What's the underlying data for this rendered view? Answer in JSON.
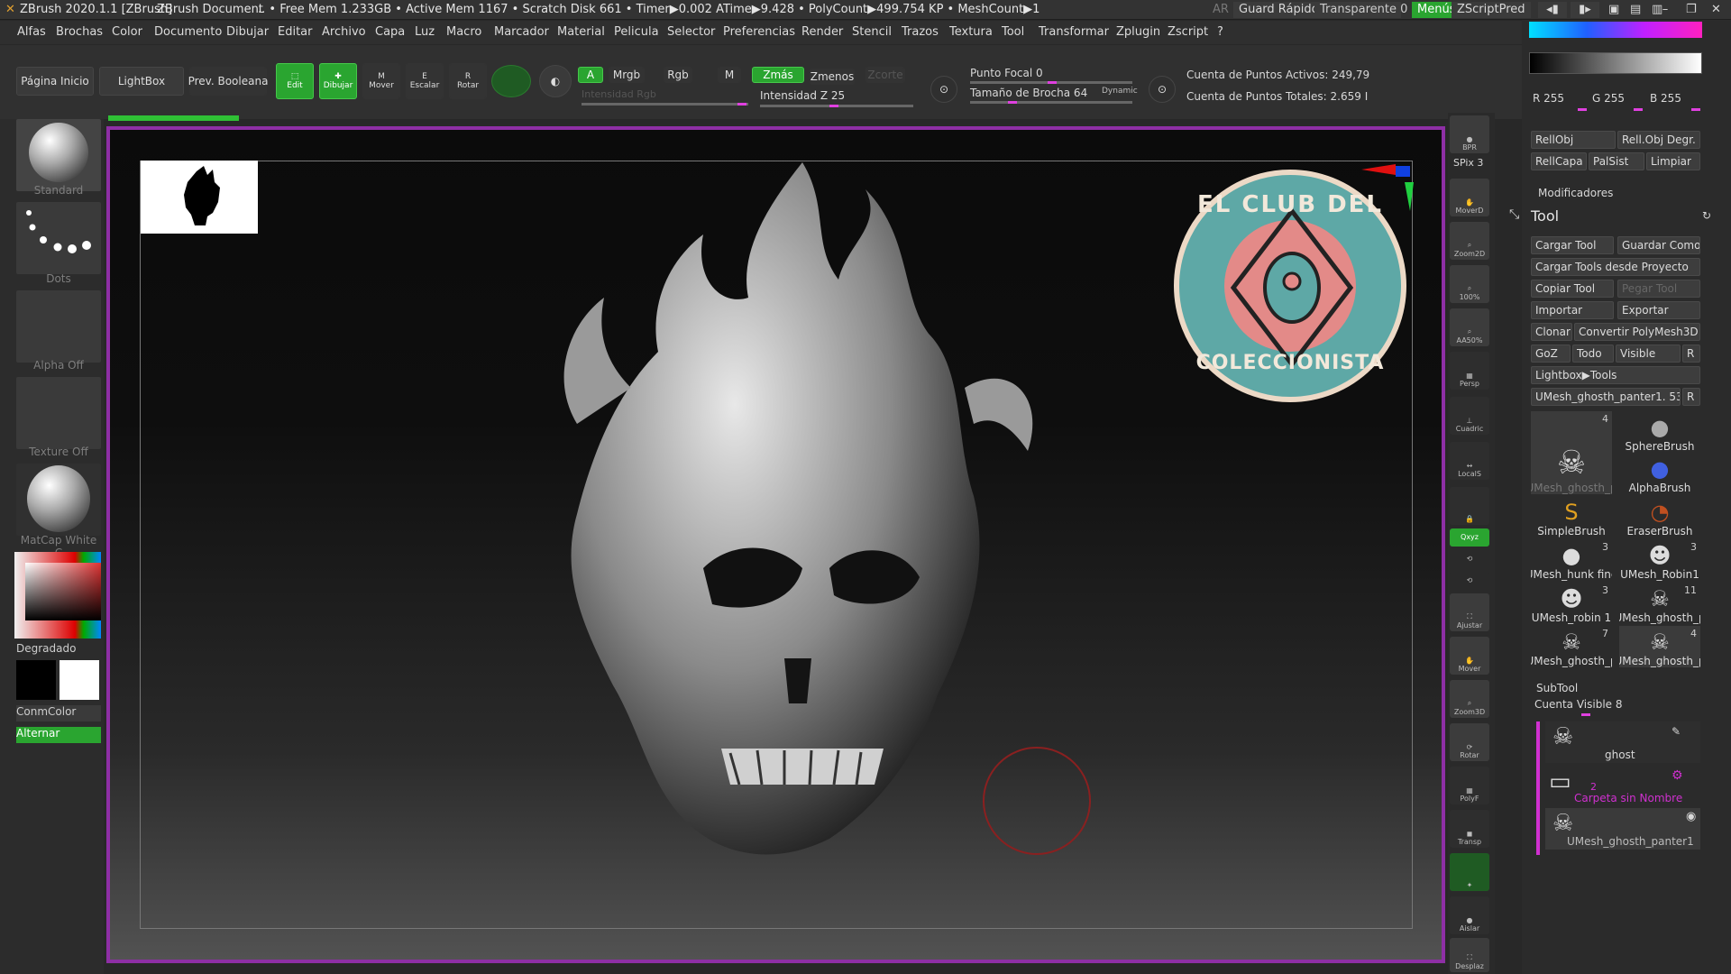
{
  "titlebar": {
    "app": "ZBrush 2020.1.1 [ZBrush]",
    "doc": "ZBrush Document",
    "stats": ".. • Free Mem 1.233GB • Active Mem 1167 • Scratch Disk 661 • Timer▶0.002 ATime▶9.428 • PolyCount▶499.754 KP • MeshCount▶1",
    "ar": "AR",
    "quicksave": "Guard Rápido",
    "transparent": "Transparente 0",
    "menus": "Menús",
    "script": "ZScriptPred"
  },
  "menubar": [
    "Alfas",
    "Brochas",
    "Color",
    "Documento",
    "Dibujar",
    "Editar",
    "Archivo",
    "Capa",
    "Luz",
    "Macro",
    "Marcador",
    "Material",
    "Pelicula",
    "Preferencias",
    "Render",
    "Selector",
    "Stencil",
    "Trazos",
    "Textura",
    "Tool",
    "Transformar",
    "Zplugin",
    "Zscript",
    "?"
  ],
  "topshelf": {
    "home": "Página Inicio",
    "lightbox": "LightBox",
    "bool": "Prev. Booleana",
    "edit": "Edit",
    "draw": "Dibujar",
    "move": "Mover",
    "scale": "Escalar",
    "rotate": "Rotar",
    "a": "A",
    "mrgb": "Mrgb",
    "rgb": "Rgb",
    "m": "M",
    "rgb_intensity": "Intensidad Rgb",
    "zadd": "Zmás",
    "zsub": "Zmenos",
    "zcut": "Zcorte",
    "z_intensity": "Intensidad Z 25",
    "focal": "Punto Focal 0",
    "brush_size": "Tamaño de Brocha 64",
    "dynamic": "Dynamic",
    "active_points": "Cuenta de Puntos Activos: 249,79",
    "total_points": "Cuenta de Puntos Totales: 2.659 I"
  },
  "leftpanel": {
    "brush": "Standard",
    "stroke": "Dots",
    "alpha": "Alpha Off",
    "texture": "Texture Off",
    "material": "MatCap White C",
    "gradient": "Degradado",
    "switch": "ConmColor",
    "alternate": "Alternar"
  },
  "canvas": {
    "logo_text_top": "EL CLUB DEL",
    "logo_text_bottom": "COLECCIONISTA"
  },
  "righttray": [
    "BPR",
    "SPix 3",
    "MoverD",
    "Zoom2D",
    "100%",
    "AA50%",
    "Persp",
    "Cuadric",
    "LocalS",
    "",
    "Qxyz",
    "",
    "",
    "Ajustar",
    "Mover",
    "Zoom3D",
    "Rotar",
    "PolyF",
    "Transp",
    "",
    "Aislar",
    "Desplaz"
  ],
  "rightpanel": {
    "r": "R 255",
    "g": "G 255",
    "b": "B 255",
    "fillobj": "RellObj",
    "fillobj_grad": "Rell.Obj Degr.",
    "filllayer": "RellCapa",
    "palsist": "PalSist",
    "clear": "Limpiar",
    "modifiers": "Modificadores",
    "tool_title": "Tool",
    "load_tool": "Cargar Tool",
    "save_as": "Guardar Como",
    "load_from_project": "Cargar Tools desde Proyecto",
    "copy_tool": "Copiar Tool",
    "paste_tool": "Pegar Tool",
    "import": "Importar",
    "export": "Exportar",
    "clone": "Clonar",
    "convert": "Convertir PolyMesh3D",
    "goz": "GoZ",
    "all": "Todo",
    "visible": "Visible",
    "r_btn": "R",
    "lightbox_tools": "Lightbox▶Tools",
    "current_tool": "UMesh_ghosth_panter1. 53",
    "tools": [
      {
        "name": "UMesh_ghosth_p",
        "count": "4"
      },
      {
        "name": "SphereBrush",
        "count": ""
      },
      {
        "name": "",
        "count": ""
      },
      {
        "name": "AlphaBrush",
        "count": ""
      },
      {
        "name": "SimpleBrush",
        "count": ""
      },
      {
        "name": "EraserBrush",
        "count": ""
      },
      {
        "name": "UMesh_hunk fine",
        "count": "3"
      },
      {
        "name": "UMesh_Robin1",
        "count": "3"
      },
      {
        "name": "UMesh_robin 1",
        "count": "3"
      },
      {
        "name": "UMesh_ghosth_p",
        "count": "11"
      },
      {
        "name": "UMesh_ghosth_p",
        "count": "7"
      },
      {
        "name": "UMesh_ghosth_p",
        "count": "4"
      }
    ],
    "subtool": "SubTool",
    "visible_count": "Cuenta Visible 8",
    "sub_ghost": "ghost",
    "folder_count": "2",
    "folder_name": "Carpeta sin Nombre",
    "sub_last": "UMesh_ghosth_panter1"
  }
}
